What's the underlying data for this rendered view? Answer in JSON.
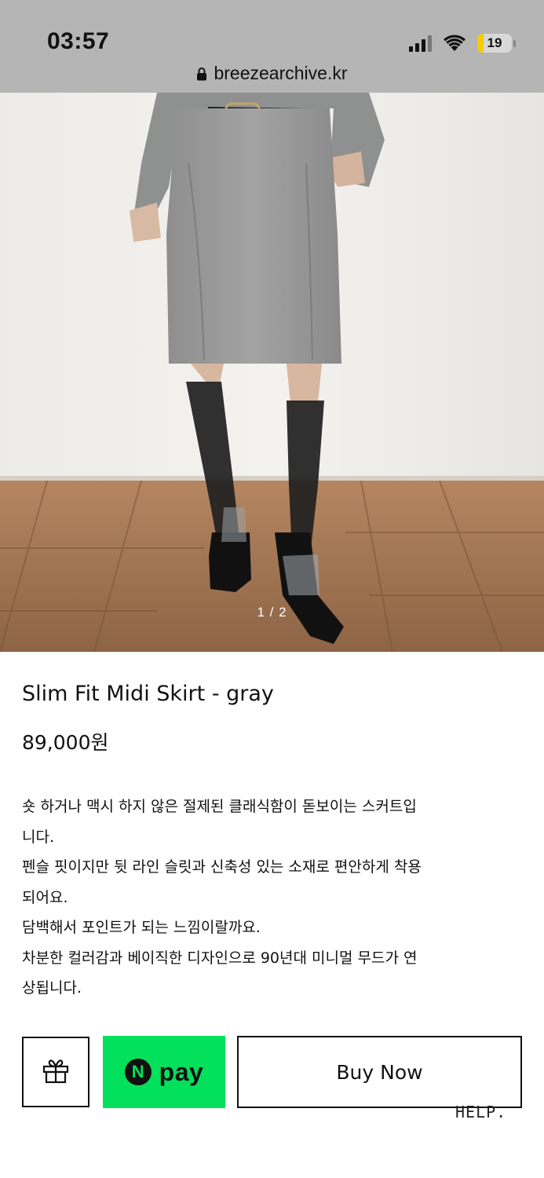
{
  "status_bar": {
    "time": "03:57",
    "battery": "19",
    "battery_level": 0.19,
    "icons": [
      "cellular-signal-icon",
      "wifi-icon",
      "battery-icon"
    ]
  },
  "browser": {
    "url": "breezearchive.kr",
    "icons": [
      "lock-icon"
    ]
  },
  "gallery": {
    "counter": "1 / 2",
    "current": 1,
    "total": 2
  },
  "product": {
    "title": "Slim Fit Midi Skirt - gray",
    "price": "89,000원"
  },
  "description": {
    "lines": [
      "숏 하거나 맥시 하지 않은 절제된 클래식함이 돋보이는 스커트입",
      "니다.",
      "펜슬 핏이지만 뒷 라인 슬릿과 신축성 있는 소재로 편안하게 착용",
      "되어요.",
      "담백해서 포인트가 되는 느낌이랄까요.",
      "차분한 컬러감과 베이직한 디자인으로 90년대 미니멀 무드가 연",
      "상됩니다."
    ]
  },
  "actions": {
    "npay_label": "pay",
    "npay_badge": "N",
    "buy_label": "Buy Now",
    "help_label": "HELP.",
    "icons": [
      "gift-icon"
    ]
  },
  "colors": {
    "npay_green": "#03e05b",
    "battery_yellow": "#f5cc00"
  }
}
